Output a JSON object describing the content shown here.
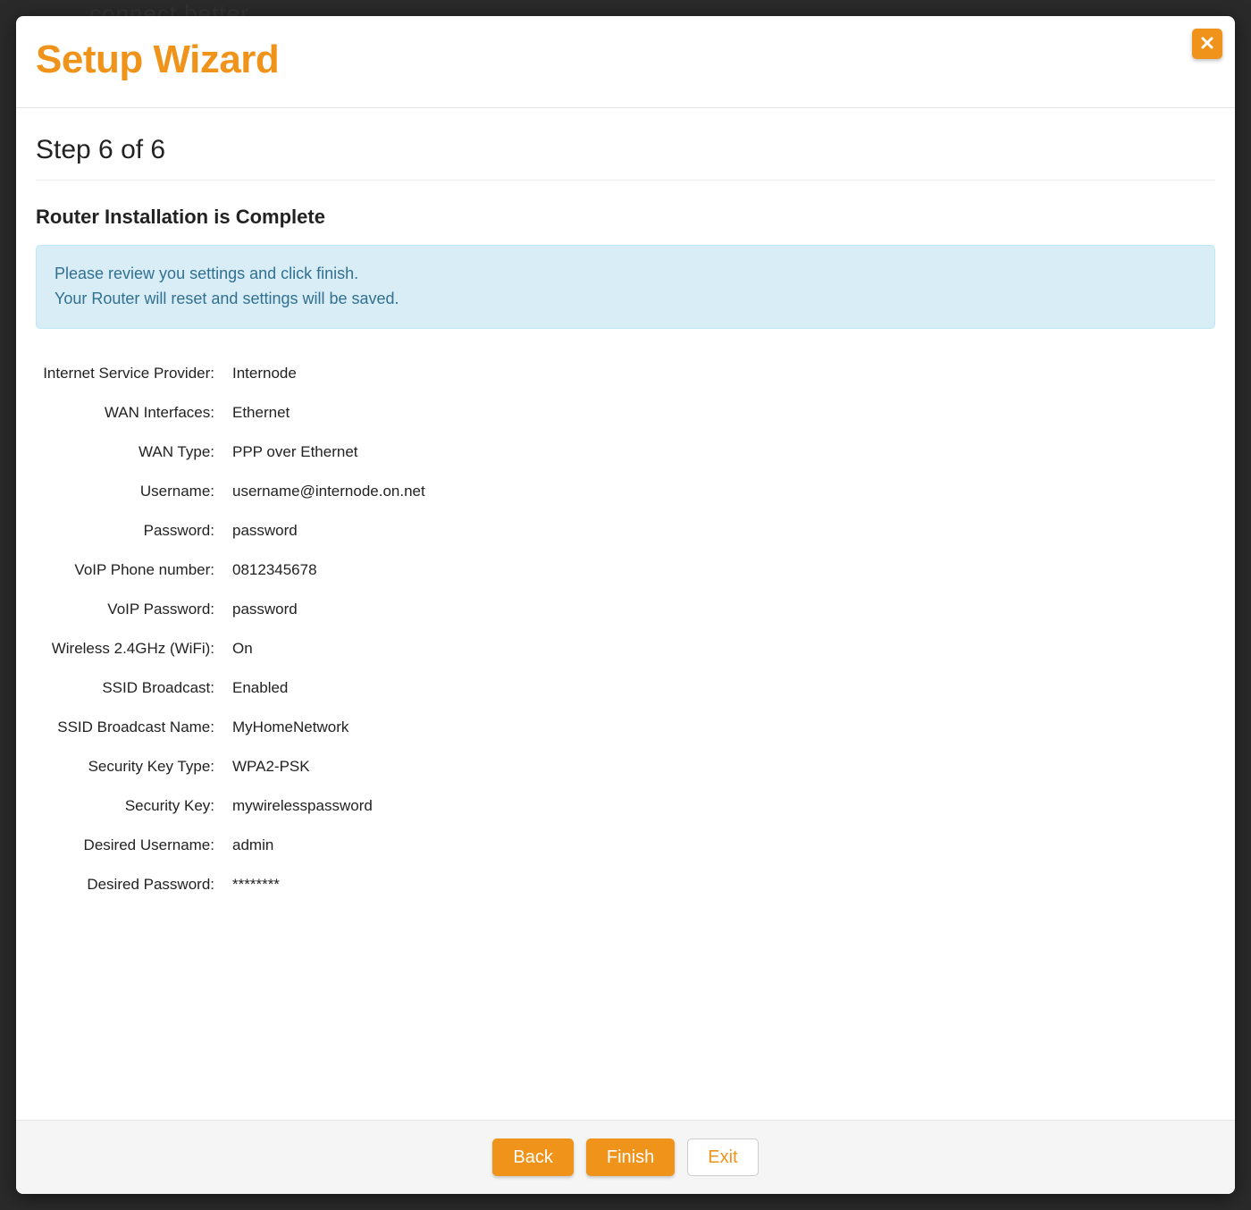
{
  "backdrop": "connect better",
  "modal": {
    "title": "Setup Wizard",
    "step": "Step 6 of 6",
    "section_title": "Router Installation is Complete",
    "alert_line1": "Please review you settings and click finish.",
    "alert_line2": "Your Router will reset and settings will be saved."
  },
  "summary": [
    {
      "label": "Internet Service Provider:",
      "value": "Internode"
    },
    {
      "label": "WAN Interfaces:",
      "value": "Ethernet"
    },
    {
      "label": "WAN Type:",
      "value": "PPP over Ethernet"
    },
    {
      "label": "Username:",
      "value": "username@internode.on.net"
    },
    {
      "label": "Password:",
      "value": "password"
    },
    {
      "label": "VoIP Phone number:",
      "value": "0812345678"
    },
    {
      "label": "VoIP Password:",
      "value": "password"
    },
    {
      "label": "Wireless 2.4GHz (WiFi):",
      "value": "On"
    },
    {
      "label": "SSID Broadcast:",
      "value": "Enabled"
    },
    {
      "label": "SSID Broadcast Name:",
      "value": "MyHomeNetwork"
    },
    {
      "label": "Security Key Type:",
      "value": "WPA2-PSK"
    },
    {
      "label": "Security Key:",
      "value": "mywirelesspassword"
    },
    {
      "label": "Desired Username:",
      "value": "admin"
    },
    {
      "label": "Desired Password:",
      "value": "********"
    }
  ],
  "buttons": {
    "back": "Back",
    "finish": "Finish",
    "exit": "Exit"
  }
}
